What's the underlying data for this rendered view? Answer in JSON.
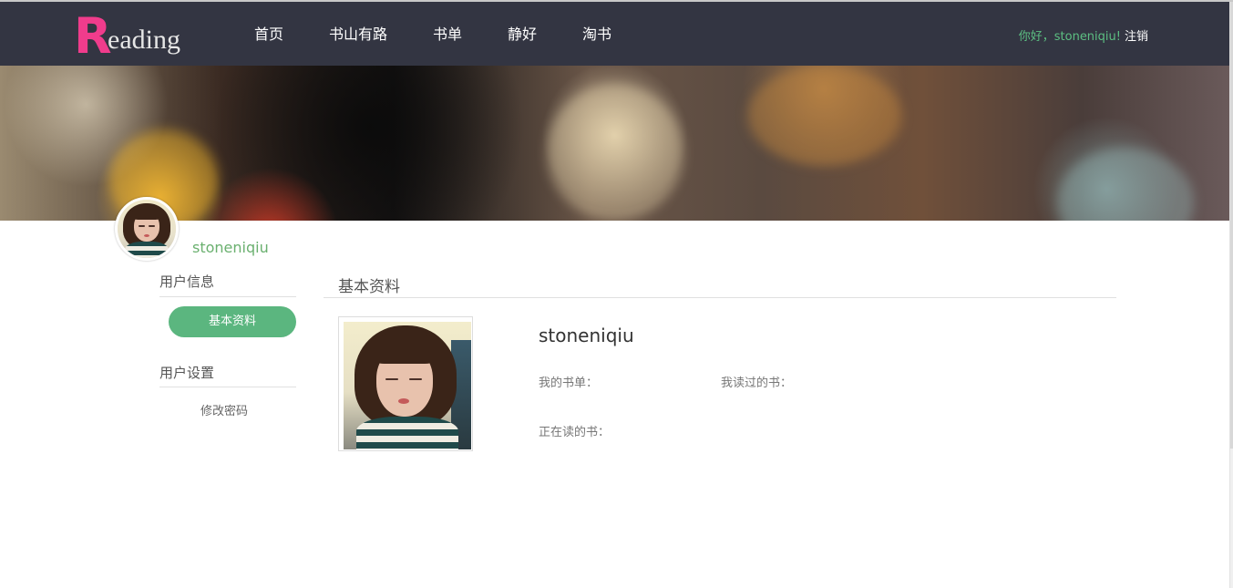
{
  "nav": {
    "logo_initial": "R",
    "logo_rest": "eading",
    "items": [
      {
        "label": "首页"
      },
      {
        "label": "书山有路"
      },
      {
        "label": "书单"
      },
      {
        "label": "静好"
      },
      {
        "label": "淘书"
      }
    ],
    "greeting": "你好，stoneniqiu!",
    "logout": "注销"
  },
  "profile": {
    "username": "stoneniqiu"
  },
  "sidebar": {
    "section1_title": "用户信息",
    "active_item": "基本资料",
    "section2_title": "用户设置",
    "change_password": "修改密码"
  },
  "main": {
    "title": "基本资料",
    "name": "stoneniqiu",
    "my_booklist_label": "我的书单：",
    "books_read_label": "我读过的书：",
    "reading_label": "正在读的书："
  },
  "colors": {
    "nav_bg": "#333542",
    "logo_accent": "#f03c8c",
    "accent_green": "#5bb67f",
    "username_green": "#6ab06f"
  }
}
